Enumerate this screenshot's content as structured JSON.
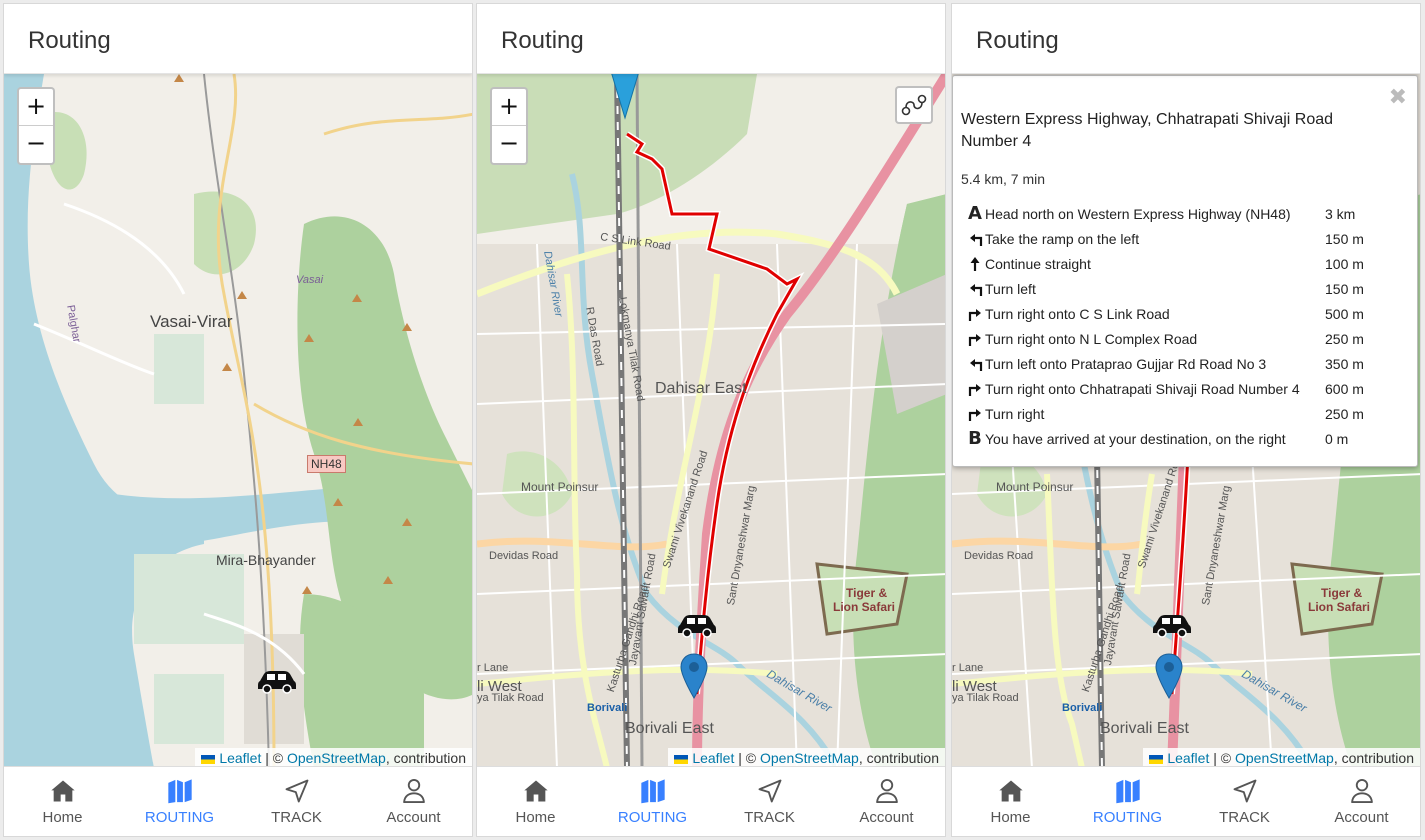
{
  "colors": {
    "accent": "#3880ff",
    "route": "#e00000",
    "water": "#aad3df",
    "park": "#add19e",
    "land": "#f2efe9"
  },
  "panels": [
    {
      "title": "Routing",
      "map_labels": {
        "city1": "Vasai-Virar",
        "city2": "Mira-Bhayander",
        "highway": "NH48",
        "palghar": "Palghar",
        "vasai": "Vasai"
      }
    },
    {
      "title": "Routing",
      "map_labels": {
        "dahisar_east": "Dahisar East",
        "mount_poinsur": "Mount Poinsur",
        "borivali_east": "Borivali East",
        "borivali": "Borivali",
        "west": "li West",
        "tilak": "ya Tilak Road",
        "devidas": "Devidas Road",
        "cs_link": "C S Link Road",
        "dahisar_river": "Dahisar River",
        "tiger": "Tiger &",
        "lion": "Lion Safari",
        "sant": "Sant Dnyaneshwar Marg",
        "jayavant": "Jayavant Sawant Road",
        "kasturba": "Kasturba Gandhi Road",
        "swami": "Swami Vivekanand Road",
        "lane": "r Lane",
        "rdas": "R Das Road",
        "tilak_road": "Lokmanya Tilak Road"
      }
    },
    {
      "title": "Routing",
      "map_labels": {
        "mount_poinsur": "Mount Poinsur",
        "borivali_east": "Borivali East",
        "borivali": "Borivali",
        "west": "li West",
        "tilak": "ya Tilak Road",
        "devidas": "Devidas Road",
        "dahisar_river": "Dahisar River",
        "tiger": "Tiger &",
        "lion": "Lion Safari",
        "sant": "Sant Dnyaneshwar Marg",
        "jayavant": "Jayavant Sawant Road",
        "kasturba": "Kasturba Gandhi Road",
        "swami": "Swami Vivekanand Road",
        "lane": "r Lane"
      }
    }
  ],
  "zoom": {
    "in": "+",
    "out": "−"
  },
  "attribution": {
    "leaflet": "Leaflet",
    "sep": "| ©",
    "osm": "OpenStreetMap",
    "rest": ", contribution"
  },
  "nav": [
    {
      "label": "Home",
      "icon": "home-icon"
    },
    {
      "label": "ROUTING",
      "icon": "map-icon"
    },
    {
      "label": "TRACK",
      "icon": "navigate-icon"
    },
    {
      "label": "Account",
      "icon": "person-icon"
    }
  ],
  "directions": {
    "close": "✖",
    "title": "Western Express Highway, Chhatrapati Shivaji Road Number 4",
    "summary": "5.4 km, 7 min",
    "steps": [
      {
        "icon": "start-a",
        "text": "Head north on Western Express Highway (NH48)",
        "distance": "3 km"
      },
      {
        "icon": "ramp-left",
        "text": "Take the ramp on the left",
        "distance": "150 m"
      },
      {
        "icon": "straight",
        "text": "Continue straight",
        "distance": "100 m"
      },
      {
        "icon": "turn-left",
        "text": "Turn left",
        "distance": "150 m"
      },
      {
        "icon": "turn-right",
        "text": "Turn right onto C S Link Road",
        "distance": "500 m"
      },
      {
        "icon": "turn-right",
        "text": "Turn right onto N L Complex Road",
        "distance": "250 m"
      },
      {
        "icon": "turn-left",
        "text": "Turn left onto Prataprao Gujjar Rd Road No 3",
        "distance": "350 m"
      },
      {
        "icon": "turn-right",
        "text": "Turn right onto Chhatrapati Shivaji Road Number 4",
        "distance": "600 m"
      },
      {
        "icon": "turn-right",
        "text": "Turn right",
        "distance": "250 m"
      },
      {
        "icon": "end-b",
        "text": "You have arrived at your destination, on the right",
        "distance": "0 m"
      }
    ]
  }
}
